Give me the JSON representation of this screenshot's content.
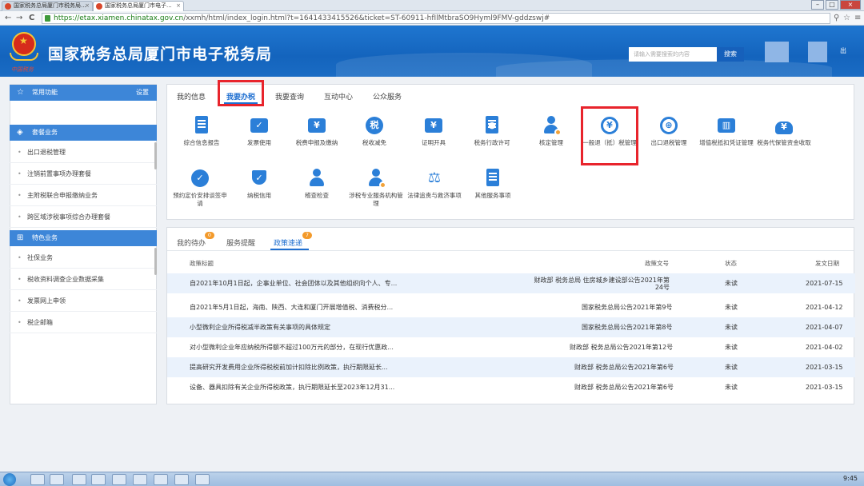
{
  "browser": {
    "tabs": [
      {
        "title": "国家税务总局厦门市税务局..."
      },
      {
        "title": "国家税务总局厦门市电子..."
      }
    ],
    "url_domain": "https://etax.xiamen.chinatax.gov.cn",
    "url_rest": "/xxmh/html/index_login.html?t=1641433415526&ticket=ST-60911-hfIlMtbraSO9Hyml9FMV-gddzswj#",
    "window_controls": {
      "minimize": "–",
      "maximize": "□",
      "close": "×"
    },
    "nav": {
      "back": "←",
      "forward": "→",
      "reload": "C"
    }
  },
  "header": {
    "title": "国家税务总局厦门市电子税务局",
    "emblem_text": "中国税务",
    "search_placeholder": "请输入需要搜索的内容",
    "search_button": "搜索",
    "right_text": "出"
  },
  "sidebar": {
    "common": {
      "label": "常用功能",
      "setting": "设置"
    },
    "package": {
      "label": "套餐业务",
      "items": [
        "出口退税管理",
        "注销前置事项办理套餐",
        "主附税联合申报缴纳业务",
        "跨区域涉税事项综合办理套餐"
      ]
    },
    "special": {
      "label": "特色业务",
      "items": [
        "社保业务",
        "税收资料调查企业数据采集",
        "发票网上申领",
        "税企邮箱"
      ]
    }
  },
  "tabs": [
    "我的信息",
    "我要办税",
    "我要查询",
    "互动中心",
    "公众服务"
  ],
  "services": [
    "综合信息报告",
    "发票使用",
    "税费申报及缴纳",
    "税收减免",
    "证明开具",
    "税务行政许可",
    "核定管理",
    "一般退（抵）税管理",
    "出口退税管理",
    "增值税抵扣凭证管理",
    "税务代保管资金收取",
    "预约定价安排谈签申请",
    "纳税信用",
    "稽查检查",
    "涉税专业服务机构管理",
    "法律追责与救济事项",
    "其他服务事项"
  ],
  "subtabs": [
    {
      "label": "我的待办",
      "badge": "0"
    },
    {
      "label": "服务提醒",
      "badge": ""
    },
    {
      "label": "政策速递",
      "badge": "7"
    }
  ],
  "table": {
    "headers": [
      "政策标题",
      "政策文号",
      "状态",
      "发文日期"
    ],
    "rows": [
      {
        "title": "自2021年10月1日起，企事业单位、社会团体以及其他组织向个人、专...",
        "doc": "财政部 税务总局 住房城乡建设部公告2021年第24号",
        "status": "未读",
        "date": "2021-07-15"
      },
      {
        "title": "自2021年5月1日起，海南、陕西、大连和厦门开展增值税、消费税分...",
        "doc": "国家税务总局公告2021年第9号",
        "status": "未读",
        "date": "2021-04-12"
      },
      {
        "title": "小型微利企业所得税减半政策有关事项的具体规定",
        "doc": "国家税务总局公告2021年第8号",
        "status": "未读",
        "date": "2021-04-07"
      },
      {
        "title": "对小型微利企业年应纳税所得额不超过100万元的部分，在现行优惠政...",
        "doc": "财政部 税务总局公告2021年第12号",
        "status": "未读",
        "date": "2021-04-02"
      },
      {
        "title": "提高研究开发费用企业所得税税前加计扣除比例政策，执行期限延长...",
        "doc": "财政部 税务总局公告2021年第6号",
        "status": "未读",
        "date": "2021-03-15"
      },
      {
        "title": "设备、器具扣除有关企业所得税政策，执行期限延长至2023年12月31...",
        "doc": "财政部 税务总局公告2021年第6号",
        "status": "未读",
        "date": "2021-03-15"
      }
    ]
  },
  "taskbar": {
    "time": "9:45"
  },
  "colors": {
    "brand": "#1f6fd0",
    "highlight": "#e8242c",
    "icon": "#2b7fd8",
    "badge": "#f39a2b"
  }
}
